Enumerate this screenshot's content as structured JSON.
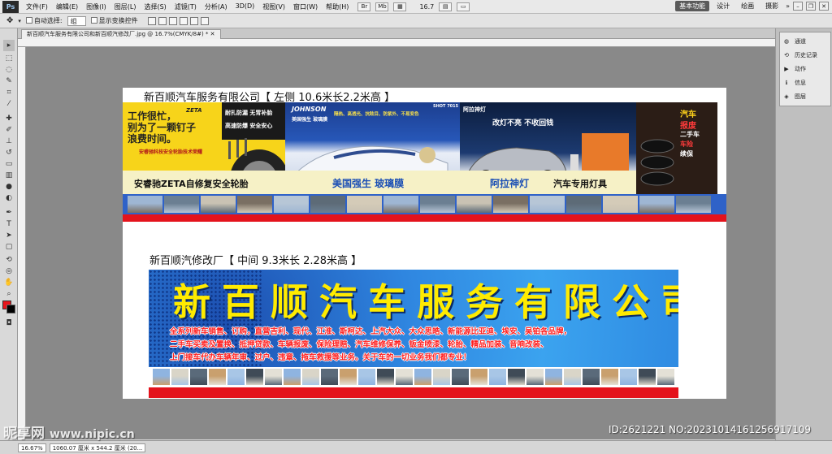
{
  "app": {
    "logo": "Ps"
  },
  "menu": [
    "文件(F)",
    "编辑(E)",
    "图像(I)",
    "图层(L)",
    "选择(S)",
    "滤镜(T)",
    "分析(A)",
    "3D(D)",
    "视图(V)",
    "窗口(W)",
    "帮助(H)"
  ],
  "menu_extras": {
    "zoom": "16.7"
  },
  "workspaces": [
    {
      "label": "基本功能",
      "active": true
    },
    {
      "label": "设计",
      "active": false
    },
    {
      "label": "绘画",
      "active": false
    },
    {
      "label": "摄影",
      "active": false
    }
  ],
  "options": {
    "auto_select_label": "自动选择:",
    "auto_select_value": "组",
    "show_transform_label": "显示变换控件"
  },
  "document_tab": "新百顺汽车服务有限公司和新百顺汽修改厂.jpg @ 16.7%(CMYK/8#) *",
  "right_panel": {
    "items": [
      {
        "label": "通道",
        "icon": "channels-icon"
      },
      {
        "label": "历史记录",
        "icon": "history-icon"
      },
      {
        "label": "动作",
        "icon": "actions-icon"
      },
      {
        "label": "信息",
        "icon": "info-icon"
      },
      {
        "label": "图层",
        "icon": "layers-icon"
      }
    ]
  },
  "canvas": {
    "caption_top": "新百顺汽车服务有限公司【 左侧  10.6米长2.2米高 】",
    "caption_mid": "新百顺汽修改厂【 中间   9.3米长  2.28米高 】",
    "panel1": {
      "headline1": "工作很忙，",
      "headline2": "别为了一颗钉子",
      "headline3": "浪费时间。",
      "sub": "安睿驰科技安全轮胎技术荣耀",
      "brand": "ZETA",
      "slogan1": "耐扎防漏  无胃补胎",
      "slogan2": "高速防爆  安全安心"
    },
    "panel2": {
      "brand": "JOHNSON",
      "brand_sub": "美国强生 玻璃膜",
      "features": "隔热、高透光、抗眩目、防紫外、不易变色",
      "code": "SHOT 7015"
    },
    "panel3": {
      "brand": "阿拉神灯",
      "slogan": "改灯不亮  不收回钱"
    },
    "panel4": {
      "t1": "汽车",
      "t2": "报废",
      "t3": "二手车",
      "t4": "车险",
      "t5": "续保"
    },
    "strip_labels": {
      "l1": "安睿驰ZETA自修复安全轮胎",
      "l2": "美国强生 玻璃膜",
      "l3": "阿拉神灯",
      "l4": "汽车专用灯具"
    },
    "big_sign": {
      "title": "新百顺汽车服务有限公司",
      "line1": "全系列新车销售、订购，直营吉利、现代、江淮、斯柯达、上汽大众、大众思皓、新能源比亚迪、埃安、吴铂各品牌，",
      "line2": "二手车买卖及置换、抵押贷款、车辆报废、保险理赔、汽车维修保养、钣金喷漆、轮胎、精品加装、音响改装、",
      "line3": "上门接车代办车辆年审、过户、违章、拖车救援等业务。关于车的一切业务我们都专业！"
    }
  },
  "status": {
    "zoom": "16.67%",
    "doc": "1060.07 厘米 x 544.2 厘米 (20..."
  },
  "watermark": {
    "site": "昵享网",
    "url": "www.nipic.cn",
    "id": "ID:2621221 NO:20231014161256917109"
  },
  "colors": {
    "sign_blue": "#2f86e0",
    "sign_yellow": "#ffeb00",
    "accent_red": "#e4131c",
    "panel_yellow": "#f7d41a"
  }
}
